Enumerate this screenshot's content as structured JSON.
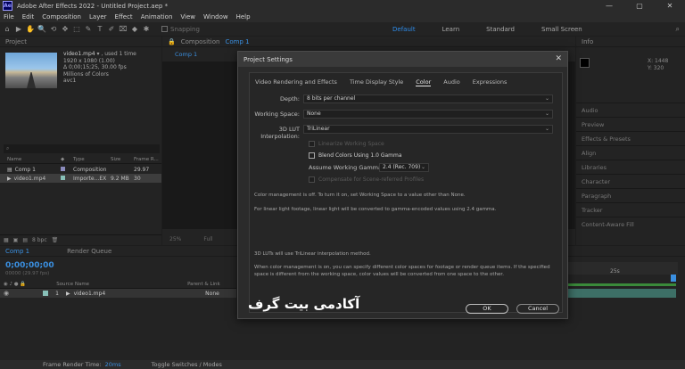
{
  "app": {
    "logo": "Ae",
    "title": "Adobe After Effects 2022 - Untitled Project.aep *"
  },
  "window_controls": [
    "—",
    "▢",
    "✕"
  ],
  "menu": [
    "File",
    "Edit",
    "Composition",
    "Layer",
    "Effect",
    "Animation",
    "View",
    "Window",
    "Help"
  ],
  "toolbar": {
    "tools": [
      "⌂",
      "▶",
      "✋",
      "🔍",
      "⟲",
      "✥",
      "⬚",
      "✎",
      "T",
      "✐",
      "⌧",
      "◆",
      "✱"
    ],
    "snapping_label": "Snapping",
    "workspaces": [
      "Default",
      "Learn",
      "Standard",
      "Small Screen"
    ],
    "active_workspace": "Default"
  },
  "project_panel": {
    "title": "Project",
    "file_name": "video1.mp4",
    "used": "▾ , used 1 time",
    "resolution": "1920 x 1080 (1.00)",
    "duration": "Δ 0;00;15;25, 30.00 fps",
    "colors": "Millions of Colors",
    "codec": "avc1",
    "columns": [
      "Name",
      "Type",
      "Size",
      "Frame R..."
    ],
    "items": [
      {
        "name": "Comp 1",
        "type": "Composition",
        "size": "",
        "rate": "29.97",
        "color": "#8b8bbc"
      },
      {
        "name": "video1.mp4",
        "type": "Importe...EX",
        "size": "9.2 MB",
        "rate": "30",
        "color": "#88c0b8"
      }
    ],
    "bpc": "8 bpc"
  },
  "composition_panel": {
    "label": "Composition",
    "comp_name": "Comp 1",
    "tab": "Comp 1",
    "footer": [
      "25%",
      "Full"
    ]
  },
  "right_panels": {
    "info_label": "Info",
    "info_vals": [
      "X: 1448",
      "Y: 320"
    ],
    "items": [
      "Audio",
      "Preview",
      "Effects & Presets",
      "Align",
      "Libraries",
      "Character",
      "Paragraph",
      "Tracker",
      "Content-Aware Fill"
    ]
  },
  "timeline": {
    "tab_comp": "Comp 1",
    "tab_render": "Render Queue",
    "timecode": "0;00;00;00",
    "timecode_sub": "00000 (29.97 fps)",
    "columns": [
      "Source Name",
      "Parent & Link"
    ],
    "layer": {
      "num": "1",
      "name": "video1.mp4",
      "parent": "None"
    },
    "ruler_marks": [
      "25s"
    ]
  },
  "status": {
    "label": "Frame Render Time:",
    "value": "20ms",
    "toggle": "Toggle Switches / Modes"
  },
  "dialog": {
    "title": "Project Settings",
    "close": "✕",
    "tabs": [
      "Video Rendering and Effects",
      "Time Display Style",
      "Color",
      "Audio",
      "Expressions"
    ],
    "active_tab": "Color",
    "depth_label": "Depth:",
    "depth_value": "8 bits per channel",
    "working_space_label": "Working Space:",
    "working_space_value": "None",
    "lut_label": "3D LUT Interpolation:",
    "lut_value": "TriLinear",
    "chk_linearize": "Linearize Working Space",
    "chk_blend": "Blend Colors Using 1.0 Gamma",
    "gamma_label": "Assume Working Gamma:",
    "gamma_value": "2.4 (Rec. 709)",
    "chk_compensate": "Compensate for Scene-referred Profiles",
    "note1": "Color management is off. To turn it on, set Working Space to a value other than None.",
    "note2": "For linear light footage, linear light will be converted to gamma-encoded values using 2.4 gamma.",
    "note3": "3D LUTs will use TriLinear interpolation method.",
    "note4": "When color management is on, you can specify different color spaces for footage or render queue items. If the specified space is different from the working space, color values will be converted from one space to the other.",
    "ok": "OK",
    "cancel": "Cancel"
  },
  "watermark": "آکادمی بیت گرف"
}
